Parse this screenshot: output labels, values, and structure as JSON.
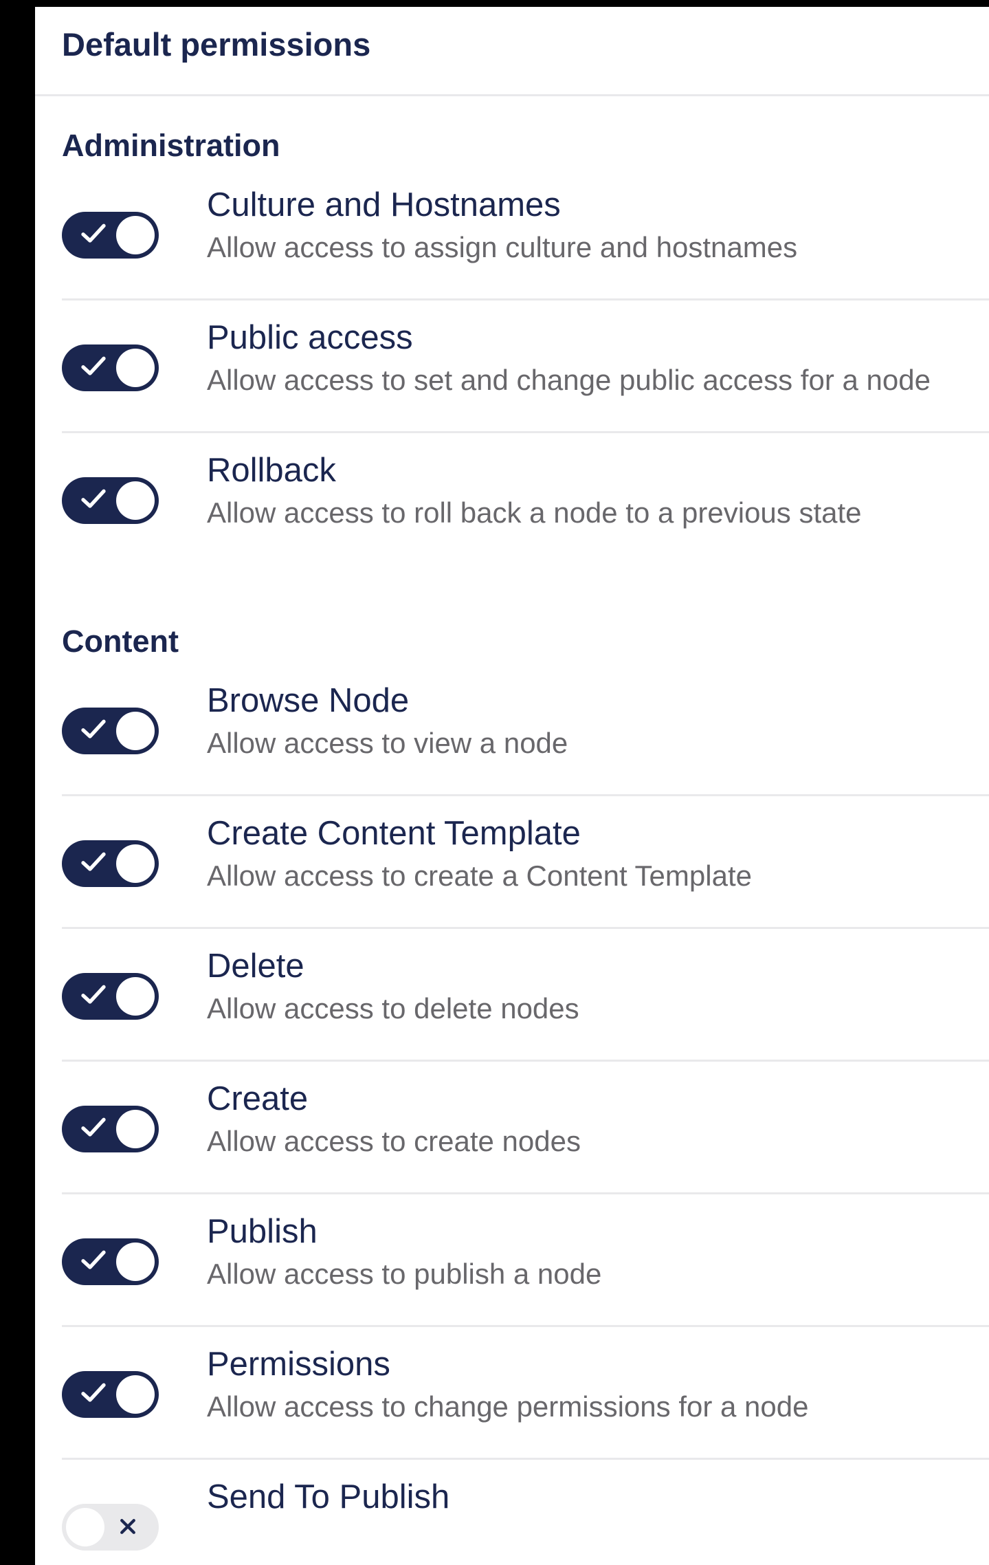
{
  "panel": {
    "title": "Default permissions"
  },
  "colors": {
    "toggle_on": "#1b264f",
    "toggle_off": "#e9e9eb",
    "heading_text": "#1b264f",
    "description_text": "#68676b",
    "divider": "#e9e9eb"
  },
  "groups": [
    {
      "heading": "Administration",
      "permissions": [
        {
          "name": "Culture and Hostnames",
          "description": "Allow access to assign culture and hostnames",
          "enabled": true,
          "icon": "check-icon"
        },
        {
          "name": "Public access",
          "description": "Allow access to set and change public access for a node",
          "enabled": true,
          "icon": "check-icon"
        },
        {
          "name": "Rollback",
          "description": "Allow access to roll back a node to a previous state",
          "enabled": true,
          "icon": "check-icon"
        }
      ]
    },
    {
      "heading": "Content",
      "permissions": [
        {
          "name": "Browse Node",
          "description": "Allow access to view a node",
          "enabled": true,
          "icon": "check-icon"
        },
        {
          "name": "Create Content Template",
          "description": "Allow access to create a Content Template",
          "enabled": true,
          "icon": "check-icon"
        },
        {
          "name": "Delete",
          "description": "Allow access to delete nodes",
          "enabled": true,
          "icon": "check-icon"
        },
        {
          "name": "Create",
          "description": "Allow access to create nodes",
          "enabled": true,
          "icon": "check-icon"
        },
        {
          "name": "Publish",
          "description": "Allow access to publish a node",
          "enabled": true,
          "icon": "check-icon"
        },
        {
          "name": "Permissions",
          "description": "Allow access to change permissions for a node",
          "enabled": true,
          "icon": "check-icon"
        },
        {
          "name": "Send To Publish",
          "description": "",
          "enabled": false,
          "icon": "cross-icon"
        }
      ]
    }
  ]
}
